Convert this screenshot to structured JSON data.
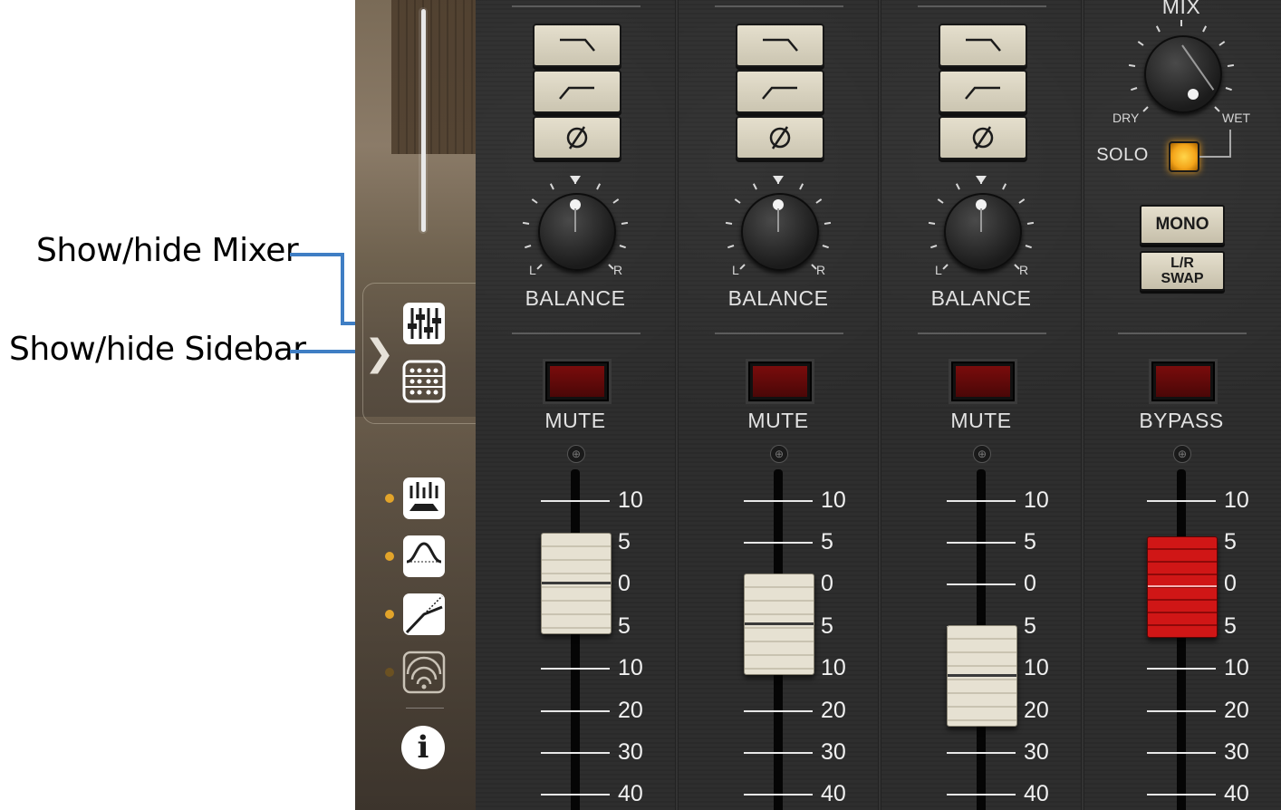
{
  "callouts": {
    "mixer": "Show/hide Mixer",
    "sidebar": "Show/hide Sidebar"
  },
  "sidebar": {
    "toggle_glyph": "❯",
    "info_glyph": "i",
    "icons": [
      "mixer-icon",
      "sidebar-icon",
      "room-mics-icon",
      "eq-icon",
      "compressor-icon",
      "reverb-icon",
      "info-icon"
    ],
    "active_dot_color": "#e2a42a"
  },
  "channels": [
    {
      "balance_label": "BALANCE",
      "left": "L",
      "right": "R",
      "mute_label": "MUTE",
      "fader_level": "0 to 5"
    },
    {
      "balance_label": "BALANCE",
      "left": "L",
      "right": "R",
      "mute_label": "MUTE",
      "fader_level": "5"
    },
    {
      "balance_label": "BALANCE",
      "left": "L",
      "right": "R",
      "mute_label": "MUTE",
      "fader_level": "10"
    }
  ],
  "master": {
    "mix_label": "MIX",
    "dry_label": "DRY",
    "wet_label": "WET",
    "solo_label": "SOLO",
    "mono_label": "MONO",
    "lr_swap_line1": "L/R",
    "lr_swap_line2": "SWAP",
    "bypass_label": "BYPASS"
  },
  "scale": [
    "10",
    "5",
    "0",
    "5",
    "10",
    "20",
    "30",
    "40"
  ],
  "colors": {
    "accent_leader": "#3f7ec4",
    "mute_led": "#7a0c0c",
    "solo_led": "#f4a51a",
    "master_fader": "#d01616"
  }
}
